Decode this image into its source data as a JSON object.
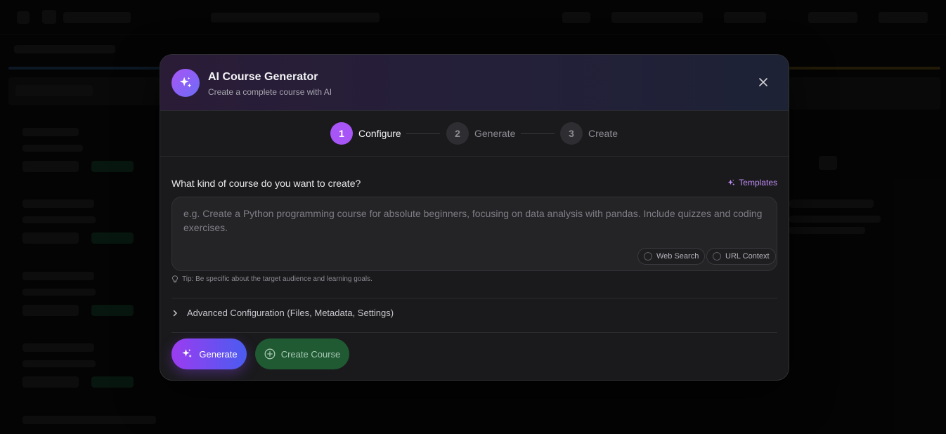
{
  "modal": {
    "title": "AI Course Generator",
    "subtitle": "Create a complete course with AI",
    "close_icon": "close-icon"
  },
  "stepper": {
    "steps": [
      {
        "number": "1",
        "label": "Configure",
        "active": true
      },
      {
        "number": "2",
        "label": "Generate",
        "active": false
      },
      {
        "number": "3",
        "label": "Create",
        "active": false
      }
    ]
  },
  "form": {
    "question": "What kind of course do you want to create?",
    "templates_label": "Templates",
    "prompt_placeholder": "e.g. Create a Python programming course for absolute beginners, focusing on data analysis with pandas. Include quizzes and coding exercises.",
    "prompt_value": "",
    "options": [
      {
        "label": "Web Search",
        "checked": false
      },
      {
        "label": "URL Context",
        "checked": false
      }
    ],
    "tip": "Tip: Be specific about the target audience and learning goals.",
    "advanced_label": "Advanced Configuration (Files, Metadata, Settings)"
  },
  "actions": {
    "generate_label": "Generate",
    "create_label": "Create Course"
  },
  "colors": {
    "accent_purple": "#a855f7",
    "accent_blue": "#4a5cf0",
    "create_green": "#1f5a33",
    "modal_bg": "#1a1a1c"
  }
}
